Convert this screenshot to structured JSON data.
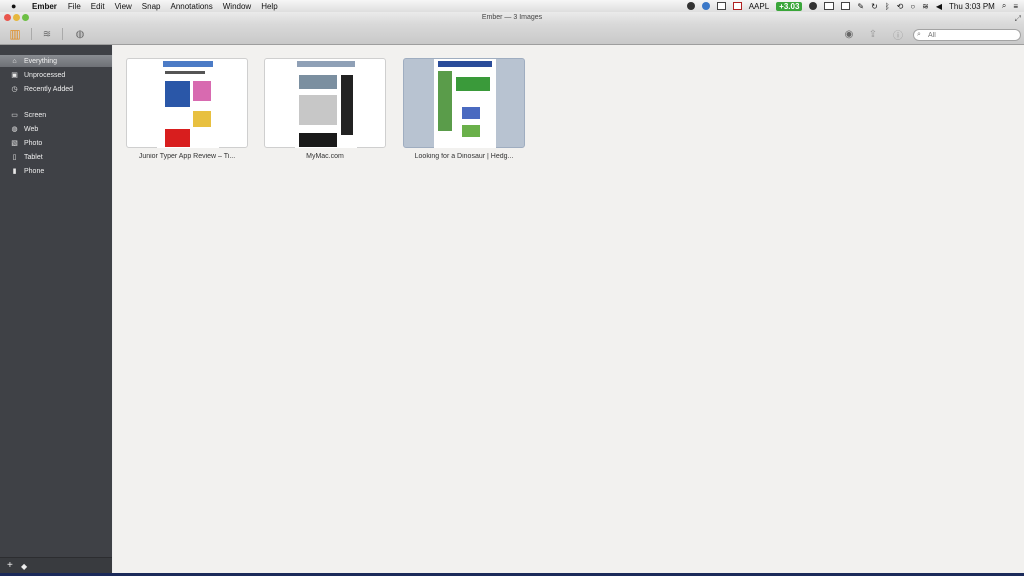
{
  "menubar": {
    "app_name": "Ember",
    "items": [
      "File",
      "Edit",
      "View",
      "Snap",
      "Annotations",
      "Window",
      "Help"
    ],
    "stock_symbol": "AAPL",
    "stock_change": "+3.03",
    "clock": "Thu 3:03 PM"
  },
  "window": {
    "title": "Ember — 3 Images"
  },
  "toolbar": {
    "search_placeholder": "All",
    "icons": [
      "library-icon",
      "rss-icon",
      "globe-icon",
      "camera-icon",
      "share-icon",
      "info-icon"
    ]
  },
  "sidebar": {
    "group1": [
      {
        "label": "Everything",
        "icon": "home-icon",
        "selected": true
      },
      {
        "label": "Unprocessed",
        "icon": "inbox-icon",
        "selected": false
      },
      {
        "label": "Recently Added",
        "icon": "clock-icon",
        "selected": false
      }
    ],
    "group2": [
      {
        "label": "Screen",
        "icon": "screen-icon"
      },
      {
        "label": "Web",
        "icon": "globe-icon"
      },
      {
        "label": "Photo",
        "icon": "photo-icon"
      },
      {
        "label": "Tablet",
        "icon": "tablet-icon"
      },
      {
        "label": "Phone",
        "icon": "phone-icon"
      }
    ]
  },
  "images": [
    {
      "title": "Junior Typer App Review – Ti...",
      "selected": false
    },
    {
      "title": "MyMac.com",
      "selected": false
    },
    {
      "title": "Looking for a Dinosaur | Hedg...",
      "selected": true
    }
  ],
  "colors": {
    "sidebar_bg": "#3f4146",
    "content_bg": "#f2f1ef",
    "selected_card": "#b8c3d1"
  }
}
